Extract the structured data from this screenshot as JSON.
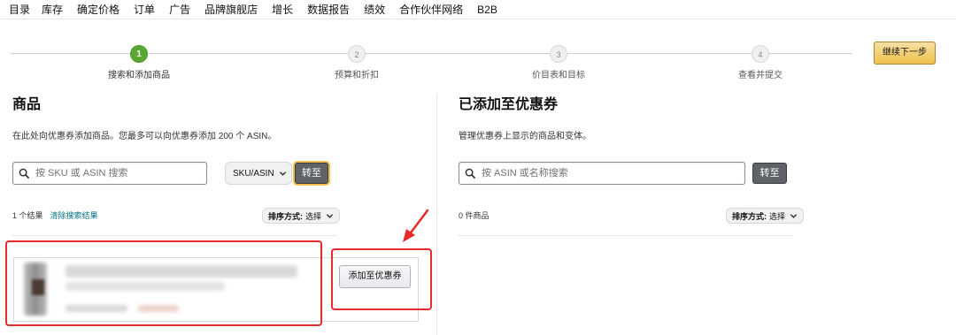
{
  "nav": {
    "items": [
      "目录",
      "库存",
      "确定价格",
      "订单",
      "广告",
      "品牌旗舰店",
      "增长",
      "数据报告",
      "绩效",
      "合作伙伴网络",
      "B2B"
    ]
  },
  "stepper": {
    "steps": [
      {
        "number": "1",
        "label": "搜索和添加商品",
        "active": true
      },
      {
        "number": "2",
        "label": "预算和折扣",
        "active": false
      },
      {
        "number": "3",
        "label": "价目表和目标",
        "active": false
      },
      {
        "number": "4",
        "label": "查看并提交",
        "active": false
      }
    ],
    "continue_label": "继续下一步"
  },
  "left": {
    "title": "商品",
    "description": "在此处向优惠券添加商品。您最多可以向优惠券添加 200 个 ASIN。",
    "search_placeholder": "按 SKU 或 ASIN 搜索",
    "select_value": "SKU/ASIN",
    "go_label": "转至",
    "results_count": "1 个结果",
    "clear_link": "清除搜索结果",
    "sort_label": "排序方式:",
    "sort_value": "选择",
    "add_button": "添加至优惠券"
  },
  "right": {
    "title": "已添加至优惠券",
    "description": "管理优惠券上显示的商品和变体。",
    "search_placeholder": "按 ASIN 或名称搜索",
    "go_label": "转至",
    "count": "0 件商品",
    "sort_label": "排序方式:",
    "sort_value": "选择"
  },
  "colors": {
    "active_step": "#5aa733",
    "continue_button": "#f0c14b",
    "link": "#007185",
    "annotation_red": "#e52b2b",
    "dark_button": "#5f6368"
  }
}
